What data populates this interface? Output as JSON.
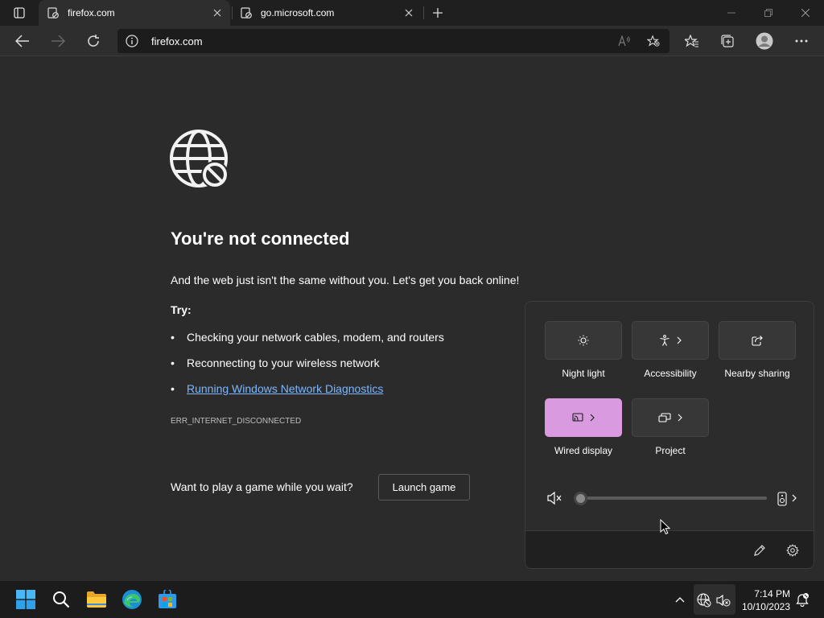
{
  "tabs": [
    {
      "title": "firefox.com",
      "active": true
    },
    {
      "title": "go.microsoft.com",
      "active": false
    }
  ],
  "address": {
    "url": "firefox.com"
  },
  "error": {
    "title": "You're not connected",
    "subtitle": "And the web just isn't the same without you. Let's get you back online!",
    "try_label": "Try:",
    "tips": [
      "Checking your network cables, modem, and routers",
      "Reconnecting to your wireless network",
      "Running Windows Network Diagnostics"
    ],
    "bullet": "•",
    "code": "ERR_INTERNET_DISCONNECTED",
    "game_prompt": "Want to play a game while you wait?",
    "game_button": "Launch game"
  },
  "quick_settings": {
    "tiles": [
      {
        "label": "Night light",
        "icon": "brightness-icon",
        "on": false,
        "has_chevron": false
      },
      {
        "label": "Accessibility",
        "icon": "accessibility-icon",
        "on": false,
        "has_chevron": true
      },
      {
        "label": "Nearby sharing",
        "icon": "share-icon",
        "on": false,
        "has_chevron": false
      },
      {
        "label": "Wired display",
        "icon": "cast-icon",
        "on": true,
        "has_chevron": true
      },
      {
        "label": "Project",
        "icon": "project-icon",
        "on": false,
        "has_chevron": true
      }
    ],
    "volume": {
      "muted": true,
      "level": 0
    },
    "accent_color": "#d99ae0"
  },
  "taskbar": {
    "time": "7:14 PM",
    "date": "10/10/2023"
  },
  "colors": {
    "link": "#7cb7ff",
    "page_bg": "#2b2b2b"
  }
}
